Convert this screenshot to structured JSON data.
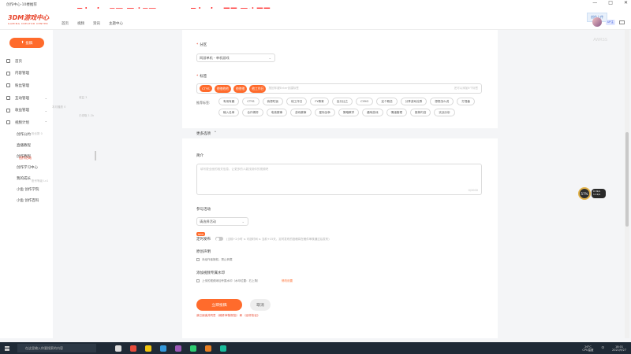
{
  "window": {
    "title": "创作中心-10楼推荐",
    "overlay_left": "队友强则强",
    "overlay_right": "队友弱则弱",
    "controls": [
      "—",
      "□",
      "✕"
    ]
  },
  "header": {
    "logo_text": "3DM游戏中心",
    "logo_sub": "GAMING CREATOR CENTER",
    "nav": [
      "首页",
      "视频",
      "资讯",
      "主题中心"
    ],
    "upload_chip": "创作上传",
    "badge": "UP主",
    "ghost": "AWRSS"
  },
  "sidebar": {
    "publish": "投稿",
    "items": [
      {
        "label": "首页",
        "icon": "home-icon",
        "chev": ""
      },
      {
        "label": "内容管理",
        "icon": "content-icon",
        "chev": ""
      },
      {
        "label": "粉丝管理",
        "icon": "fans-icon",
        "chev": ""
      },
      {
        "label": "互动管理",
        "icon": "chat-icon",
        "chev": "⌄"
      },
      {
        "label": "收益管理",
        "icon": "money-icon",
        "chev": "⌄"
      },
      {
        "label": "视频计划",
        "icon": "plan-icon",
        "chev": "⌃"
      }
    ],
    "subs": [
      "创作公约",
      "直播教程",
      "创作教程",
      "创作学习中心",
      "我的成长",
      "小鱼 创作学院",
      "小鱼 创作百科"
    ],
    "blurbs": [
      "收益 3",
      "本月播放 0",
      "已领取 1.2k",
      "粉丝数 0",
      "账号等级 Lv1"
    ],
    "red_item": "创作活动"
  },
  "form": {
    "category_label": "分区",
    "category_value": "网游单机 - 单机游戏",
    "tags_label": "标签",
    "tags": [
      "CTYS",
      "他他他他",
      "他他他",
      "他工作日"
    ],
    "tags_placeholder": "按回车键Enter创建标签",
    "tags_count": "还可以添加6个标签",
    "rec_label": "推荐标签:",
    "recs": [
      "有用有趣",
      "CTYS",
      "我想吃饭",
      "他工作日",
      "FY教育",
      "百分比之",
      "CYHO",
      "这个概念",
      "分享游戏社群",
      "想想怎么说",
      "打怪兽",
      "输入名单",
      "合作博弈",
      "电竞赛事",
      "游戏赛事",
      "星际战争",
      "策略教学",
      "趣味游戏",
      "情绪管理",
      "推荐内容",
      "实战分析"
    ],
    "more_label": "更多选项",
    "intro_label": "简介",
    "intro_placeholder": "填写更全面的相关信息，让更多的人能找到你的视频吧",
    "intro_count": "0/2000",
    "activity_label": "参与活动",
    "activity_value": "请选择活动",
    "new_badge": "NEW",
    "schedule_label": "定时发布",
    "schedule_hint": "(当前+2小时 ≤ 可选时间 ≤ 当前+15天，定时发布的投稿将在稿件审核通过后发布)",
    "declare_label": "原创声明",
    "declare_option": "未经作者授权，禁止转载",
    "watermark_label": "添加视频专属水印",
    "watermark_option": "上传的视频添加专属水印（水印位置：右上角）",
    "watermark_link": "修改设置",
    "submit": "立即投稿",
    "cancel": "取消",
    "warn": "我已阅读并同意 《稿件审核规范》 和 《创作协议》"
  },
  "widgets": {
    "float_value": "57",
    "float_unit": "%",
    "pill_line1": "0.3k/s",
    "pill_line2": "1.1k/s"
  },
  "taskbar": {
    "search_placeholder": "在这里输入你要搜索的内容",
    "weather": "26°C",
    "weather_sub": "CPU温度",
    "time": "18:01",
    "date": "2021/9/27",
    "lang": "中"
  },
  "colors": {
    "accent": "#ff6b2c",
    "overlay": "#ff2a2a",
    "taskbar": "#1f2a36"
  }
}
